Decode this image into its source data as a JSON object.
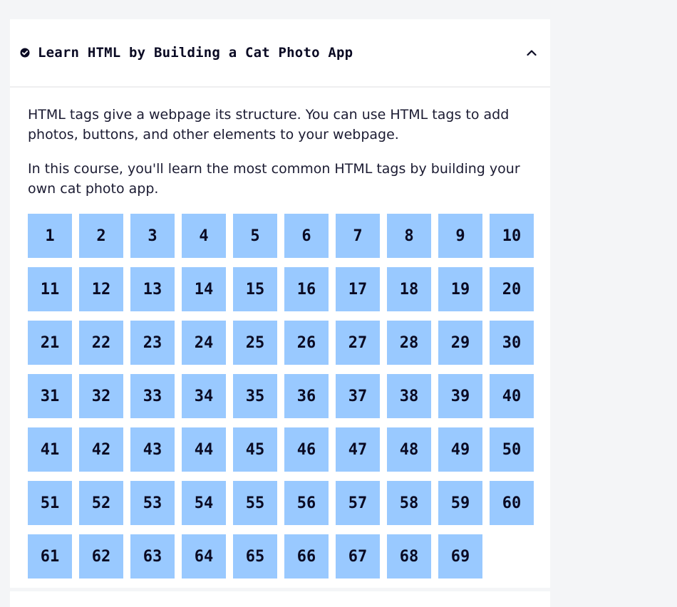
{
  "course": {
    "title": "Learn HTML by Building a Cat Photo App",
    "status_icon": "check-circle-icon",
    "toggle_icon": "chevron-up-icon",
    "description": [
      "HTML tags give a webpage its structure. You can use HTML tags to add photos, buttons, and other elements to your webpage.",
      "In this course, you'll learn the most common HTML tags by building your own cat photo app."
    ],
    "steps": [
      "1",
      "2",
      "3",
      "4",
      "5",
      "6",
      "7",
      "8",
      "9",
      "10",
      "11",
      "12",
      "13",
      "14",
      "15",
      "16",
      "17",
      "18",
      "19",
      "20",
      "21",
      "22",
      "23",
      "24",
      "25",
      "26",
      "27",
      "28",
      "29",
      "30",
      "31",
      "32",
      "33",
      "34",
      "35",
      "36",
      "37",
      "38",
      "39",
      "40",
      "41",
      "42",
      "43",
      "44",
      "45",
      "46",
      "47",
      "48",
      "49",
      "50",
      "51",
      "52",
      "53",
      "54",
      "55",
      "56",
      "57",
      "58",
      "59",
      "60",
      "61",
      "62",
      "63",
      "64",
      "65",
      "66",
      "67",
      "68",
      "69"
    ]
  },
  "colors": {
    "step_bg": "#99c9ff",
    "text": "#0a0a23",
    "page_bg": "#f4f5f7"
  }
}
